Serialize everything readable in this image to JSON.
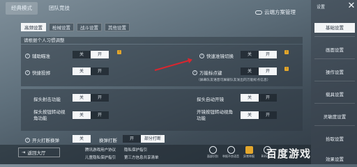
{
  "top_tabs": {
    "classic_mode": "经典模式",
    "team_competition": "团队竞技"
  },
  "cloud_save": "云端方案管理",
  "sub_tabs": [
    "高频设置",
    "枪械设置",
    "战斗设置",
    "其他设置"
  ],
  "section_header": "请根据个人习惯调整",
  "toggles": {
    "off": "关",
    "on": "开"
  },
  "settings": [
    {
      "label": "辅助瞄准",
      "state": "on"
    },
    {
      "label": "快速准镜切换",
      "state": "on"
    },
    {
      "label": "快捷投掷",
      "state": "off"
    },
    {
      "label": "万能标点键",
      "state": "on",
      "note": "（屏幕队友语音可屏蔽队友发出的万能标点信息）"
    },
    {
      "label": "探头射击功能",
      "state": "off"
    },
    {
      "label": "探头自动开镜",
      "state": "off"
    },
    {
      "label": "探头按钮转动视角功能",
      "state": "off"
    },
    {
      "label": "开镜按钮转动视角功能",
      "state": "off"
    },
    {
      "label": "开火打断换弹",
      "state": "off"
    },
    {
      "label": "换弹打断",
      "state": "partial"
    }
  ],
  "partial_label": "部分打断",
  "sidebar": {
    "settings_label": "设置",
    "items": [
      "基础设置",
      "画面设置",
      "操作设置",
      "载具设置",
      "灵敏度设置",
      "拾取设置",
      "效果设置"
    ]
  },
  "close_icon": "close-icon",
  "bottom": {
    "return_label": "返回大厅",
    "links": [
      "腾讯游戏用户协议",
      "隐私保护指引",
      "儿童隐私保护指引",
      "第三方信息共享清单"
    ],
    "icons": [
      {
        "name": "face-icon",
        "label": "面部识别"
      },
      {
        "name": "report-icon",
        "label": "举报不良语音"
      },
      {
        "name": "warning-icon",
        "label": "异常举报"
      },
      {
        "name": "bus-icon",
        "label": "BUG反馈"
      },
      {
        "name": "guide-icon",
        "label": "新手"
      }
    ],
    "watermark": "百度游戏"
  },
  "colors": {
    "accent_red": "#d9262f",
    "badge": "#e4a72c"
  }
}
